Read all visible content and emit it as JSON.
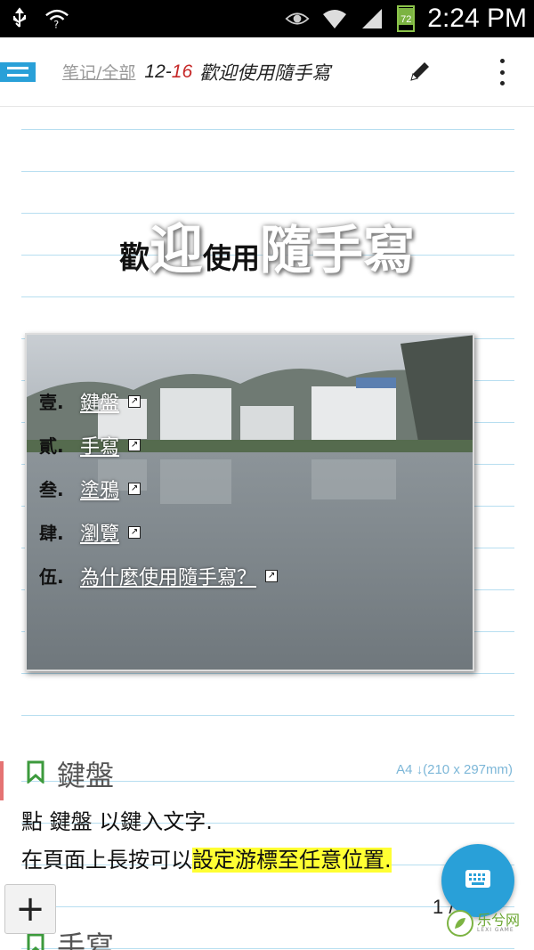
{
  "status_bar": {
    "time": "2:24 PM",
    "battery": "72",
    "icons": [
      "usb-icon",
      "wifi-question-icon",
      "eye-icon",
      "wifi-icon",
      "signal-icon",
      "battery-icon"
    ]
  },
  "app_bar": {
    "menu_icon": "list-menu-icon",
    "breadcrumb": "笔记/全部",
    "date_month": "12-",
    "date_day": "16",
    "title": "歡迎使用隨手寫",
    "edit_icon": "pencil-icon",
    "more_icon": "more-vert-icon"
  },
  "headline": {
    "part1": "歡",
    "part2": "迎",
    "part3": "使用",
    "part4": "隨手寫"
  },
  "toc": {
    "items": [
      {
        "num": "壹.",
        "label": "鍵盤"
      },
      {
        "num": "貳.",
        "label": "手寫"
      },
      {
        "num": "叁.",
        "label": "塗鴉"
      },
      {
        "num": "肆.",
        "label": "瀏覽"
      },
      {
        "num": "伍.",
        "label": "為什麼使用隨手寫？"
      }
    ]
  },
  "section1": {
    "title": "鍵盤",
    "paper_size": "A4 ↓(210 x 297mm)",
    "line1": "點 鍵盤 以鍵入文字.",
    "line2_plain": "在頁面上長按可以",
    "line2_highlight": "設定游標至任意位置."
  },
  "section2": {
    "title": "手寫"
  },
  "footer": {
    "plus_label": "+",
    "page_number": "1 / 4",
    "watermark_cn": "乐兮网",
    "watermark_en": "LEXI GAME"
  },
  "colors": {
    "accent": "#29a0d8",
    "rule_line": "#b7def0",
    "highlight": "#ffff33",
    "date_day": "#c62828"
  }
}
